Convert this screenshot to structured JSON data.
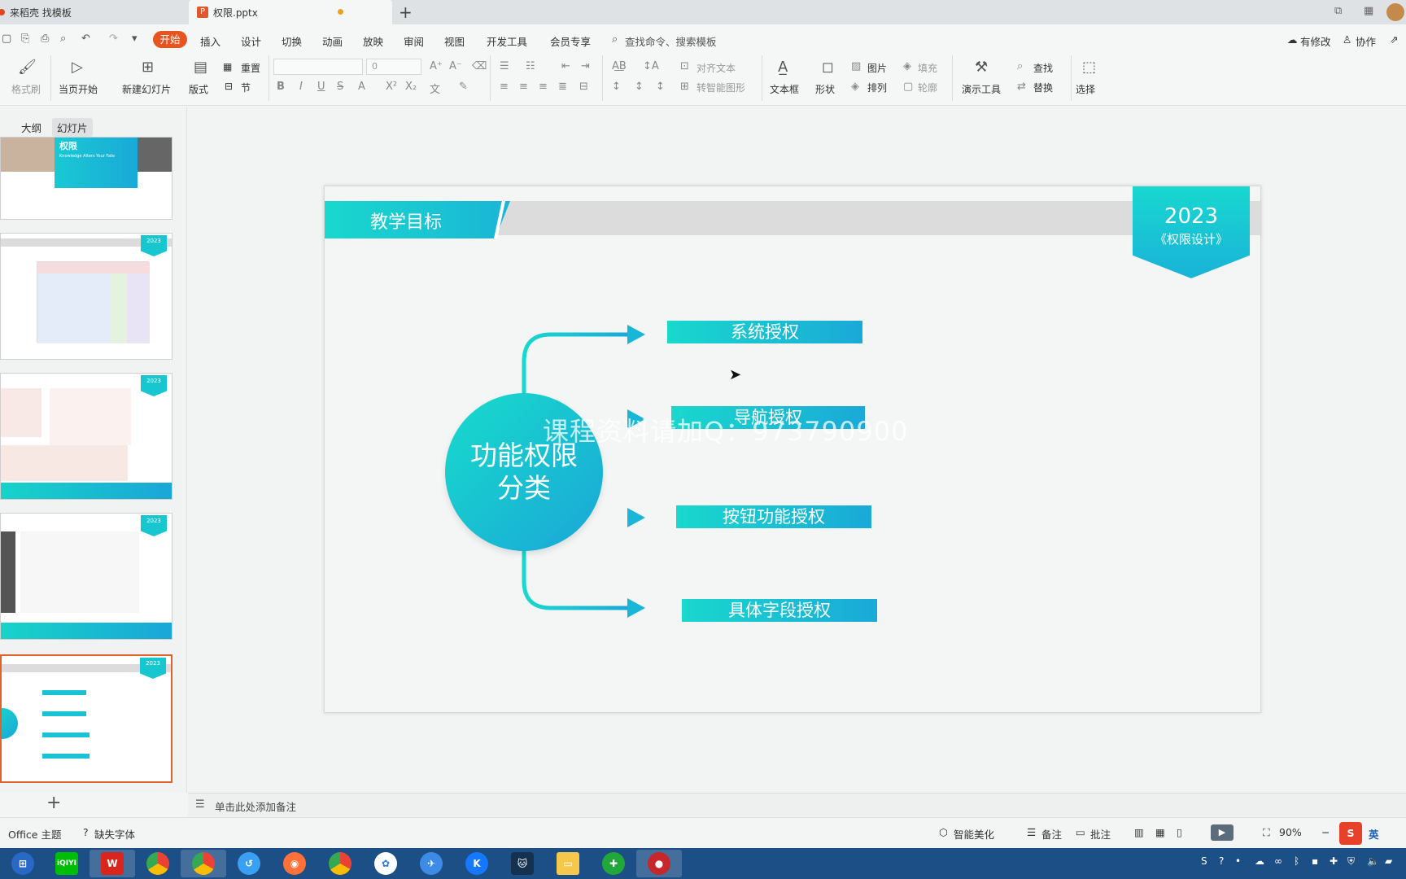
{
  "tabs": [
    {
      "label": "来稻壳 找模板",
      "active": false
    },
    {
      "label": "权限.pptx",
      "active": true,
      "icon": "ppt-file-icon"
    }
  ],
  "menu": {
    "items": [
      "开始",
      "插入",
      "设计",
      "切换",
      "动画",
      "放映",
      "审阅",
      "视图",
      "开发工具",
      "会员专享"
    ],
    "search_placeholder": "查找命令、搜索模板",
    "right": [
      "有修改",
      "协作"
    ]
  },
  "ribbon": {
    "format_painter": "格式刷",
    "from_current": "当页开始",
    "new_slide": "新建幻灯片",
    "layout": "版式",
    "section": "节",
    "reset": "重置",
    "font_size": "0",
    "text_align": "对齐文本",
    "smart_shape": "转智能图形",
    "textbox": "文本框",
    "shape": "形状",
    "picture": "图片",
    "arrange": "排列",
    "fill": "填充",
    "outline": "轮廓",
    "present_tools": "演示工具",
    "find": "查找",
    "replace": "替换",
    "select": "选择"
  },
  "left_panel": {
    "tab_outline": "大纲",
    "tab_slides": "幻灯片",
    "thumb1_title": "权限",
    "thumb1_sub": "Knowledge Alters Your Fate",
    "thumb_badge": "2023"
  },
  "slide": {
    "header": "教学目标",
    "year": "2023",
    "subtitle": "《权限设计》",
    "center_line1": "功能权限",
    "center_line2": "分类",
    "branches": [
      "系统授权",
      "导航授权",
      "按钮功能授权",
      "具体字段授权"
    ],
    "watermark": "课程资料请加Q：973790900"
  },
  "notes_placeholder": "单击此处添加备注",
  "status": {
    "theme": "Office 主题",
    "missing_font": "缺失字体",
    "smart_beautify": "智能美化",
    "notes": "备注",
    "comments": "批注",
    "zoom": "90%",
    "ime": "英"
  },
  "taskbar": {
    "apps": [
      "iQIYI",
      "WPS",
      "Chrome",
      "Chrome",
      "Feishu",
      "Firefox",
      "Chrome",
      "Tencent",
      "Feiyu",
      "K",
      "Cat",
      "Explorer",
      "360",
      "Recorder"
    ]
  },
  "colors": {
    "accent": "#e7541f",
    "teal": "#19d3cd",
    "blue": "#1aa6d8",
    "taskbar": "#1b4f86"
  }
}
